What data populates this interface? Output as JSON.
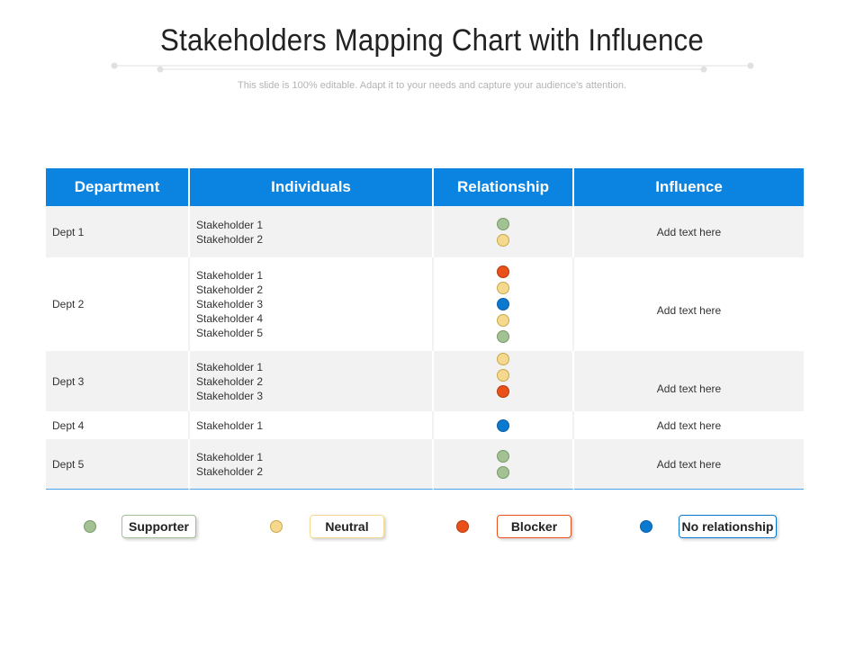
{
  "title": "Stakeholders Mapping Chart with Influence",
  "subtitle": "This slide is 100% editable. Adapt it to your needs and capture your audience's attention.",
  "colors": {
    "header": "#0a84e0",
    "supporter": "#a3c293",
    "neutral": "#f5d98e",
    "blocker": "#e8521a",
    "no_relationship": "#0a7ad1"
  },
  "table": {
    "headers": [
      "Department",
      "Individuals",
      "Relationship",
      "Influence"
    ],
    "rows": [
      {
        "department": "Dept 1",
        "individuals": [
          "Stakeholder 1",
          "Stakeholder 2"
        ],
        "relationships": [
          "supporter",
          "neutral"
        ],
        "influence": "Add text here"
      },
      {
        "department": "Dept 2",
        "individuals": [
          "Stakeholder 1",
          "Stakeholder 2",
          "Stakeholder 3",
          "Stakeholder 4",
          "Stakeholder 5"
        ],
        "relationships": [
          "blocker",
          "neutral",
          "no_relationship",
          "neutral",
          "supporter"
        ],
        "influence": "Add text here"
      },
      {
        "department": "Dept 3",
        "individuals": [
          "Stakeholder 1",
          "Stakeholder 2",
          "Stakeholder 3"
        ],
        "relationships": [
          "neutral",
          "neutral",
          "blocker"
        ],
        "influence": "Add text here"
      },
      {
        "department": "Dept 4",
        "individuals": [
          "Stakeholder 1"
        ],
        "relationships": [
          "no_relationship"
        ],
        "influence": "Add text here"
      },
      {
        "department": "Dept 5",
        "individuals": [
          "Stakeholder 1",
          "Stakeholder 2"
        ],
        "relationships": [
          "supporter",
          "supporter"
        ],
        "influence": "Add text here"
      }
    ]
  },
  "legend": [
    {
      "key": "supporter",
      "label": "Supporter"
    },
    {
      "key": "neutral",
      "label": "Neutral"
    },
    {
      "key": "blocker",
      "label": "Blocker"
    },
    {
      "key": "no_relationship",
      "label": "No relationship"
    }
  ]
}
